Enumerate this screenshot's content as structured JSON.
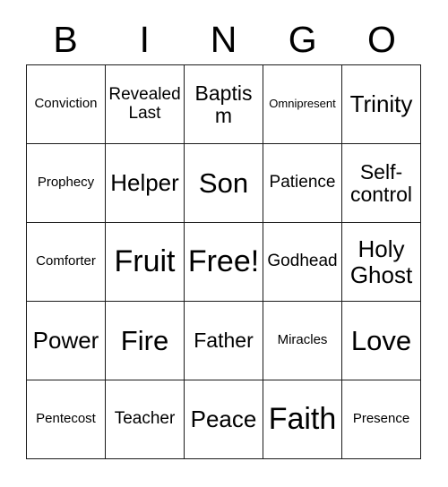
{
  "card": {
    "title_letters": [
      "B",
      "I",
      "N",
      "G",
      "O"
    ],
    "columns": 5,
    "rows": 5,
    "free_space_label": "Free!",
    "free_space_position": "center",
    "colors": {
      "background": "#ffffff",
      "text": "#000000",
      "grid_line": "#1a1a1a"
    },
    "cells": [
      [
        {
          "label": "Conviction",
          "size": "s"
        },
        {
          "label": "Revealed Last",
          "size": "m"
        },
        {
          "label": "Baptism",
          "size": "l"
        },
        {
          "label": "Omnipresent",
          "size": "xs"
        },
        {
          "label": "Trinity",
          "size": "xl"
        }
      ],
      [
        {
          "label": "Prophecy",
          "size": "s"
        },
        {
          "label": "Helper",
          "size": "xl"
        },
        {
          "label": "Son",
          "size": "xxl"
        },
        {
          "label": "Patience",
          "size": "m"
        },
        {
          "label": "Self-control",
          "size": "l"
        }
      ],
      [
        {
          "label": "Comforter",
          "size": "s"
        },
        {
          "label": "Fruit",
          "size": "xxxl"
        },
        {
          "label": "Free!",
          "size": "xxxl"
        },
        {
          "label": "Godhead",
          "size": "m"
        },
        {
          "label": "Holy Ghost",
          "size": "xl"
        }
      ],
      [
        {
          "label": "Power",
          "size": "xl"
        },
        {
          "label": "Fire",
          "size": "xxl"
        },
        {
          "label": "Father",
          "size": "l"
        },
        {
          "label": "Miracles",
          "size": "s"
        },
        {
          "label": "Love",
          "size": "xxl"
        }
      ],
      [
        {
          "label": "Pentecost",
          "size": "s"
        },
        {
          "label": "Teacher",
          "size": "m"
        },
        {
          "label": "Peace",
          "size": "xl"
        },
        {
          "label": "Faith",
          "size": "xxxl"
        },
        {
          "label": "Presence",
          "size": "s"
        }
      ]
    ]
  }
}
